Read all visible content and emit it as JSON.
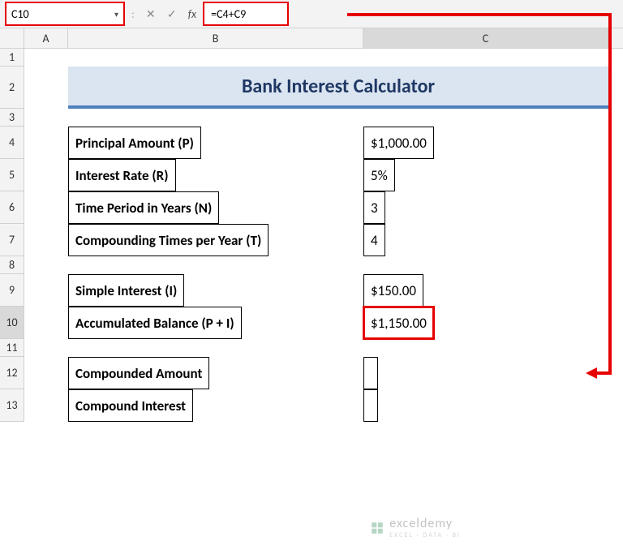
{
  "formula_bar": {
    "name_box": "C10",
    "fx_label": "fx",
    "formula": "=C4+C9"
  },
  "columns": {
    "corner": "",
    "A": "A",
    "B": "B",
    "C": "C"
  },
  "row_labels": {
    "r1": "1",
    "r2": "2",
    "r3": "3",
    "r4": "4",
    "r5": "5",
    "r6": "6",
    "r7": "7",
    "r8": "8",
    "r9": "9",
    "r10": "10",
    "r11": "11",
    "r12": "12",
    "r13": "13"
  },
  "title": "Bank Interest Calculator",
  "table": {
    "principal_label": "Principal Amount (P)",
    "principal_cur": "$",
    "principal_val": "1,000.00",
    "rate_label": "Interest Rate (R)",
    "rate_val": "5%",
    "years_label": "Time Period in Years (N)",
    "years_val": "3",
    "compounding_label": "Compounding Times per Year (T)",
    "compounding_val": "4",
    "simple_label": "Simple Interest (I)",
    "simple_cur": "$",
    "simple_val": "150.00",
    "accum_label": "Accumulated Balance (P + I)",
    "accum_cur": "$",
    "accum_val": "1,150.00",
    "compounded_label": "Compounded Amount",
    "compounded_val": "",
    "compound_int_label": "Compound Interest",
    "compound_int_val": ""
  },
  "watermark": {
    "brand": "exceldemy",
    "tagline": "EXCEL · DATA · BI"
  }
}
